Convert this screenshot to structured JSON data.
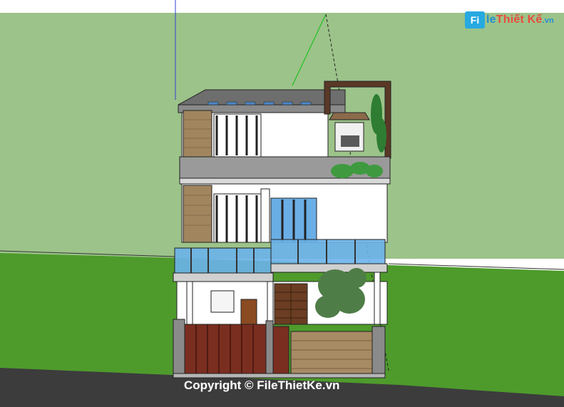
{
  "watermark": {
    "logo_mark": "Fi",
    "logo_brand_a": "le",
    "logo_brand_b": "Thiết Kế",
    "logo_suffix": ".vn"
  },
  "copyright": {
    "text": "Copyright © FileThietKe.vn"
  },
  "colors": {
    "sky": "#ffffff",
    "distant_lawn": "#9cc38a",
    "near_lawn": "#4e9b2c",
    "road": "#3f3f3f",
    "wall": "#ffffff",
    "stone": "#a0855f",
    "glass": "#5fa6e0",
    "gate": "#7a2e20",
    "roof": "#6e6e6e"
  }
}
